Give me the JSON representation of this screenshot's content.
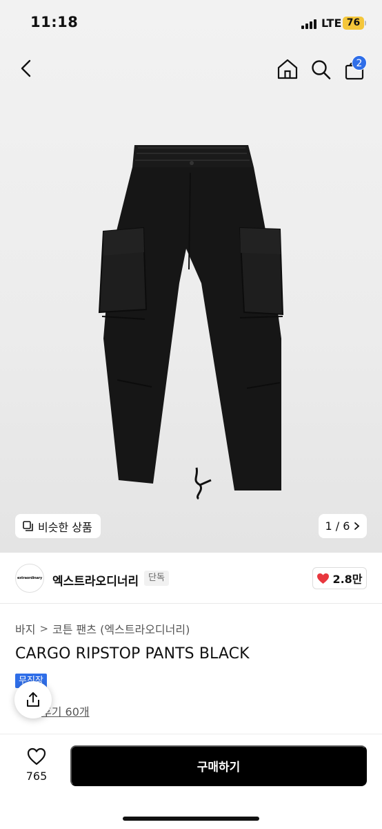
{
  "status_bar": {
    "time": "11:18",
    "network": "LTE",
    "battery": "76"
  },
  "header": {
    "cart_count": "2"
  },
  "gallery": {
    "similar_label": "비슷한 상품",
    "pager": "1 / 6"
  },
  "brand": {
    "logo_text": "extraordinary",
    "name": "엑스트라오디너리",
    "tag": "단독",
    "likes": "2.8만"
  },
  "product": {
    "breadcrumb": [
      "바지",
      "코튼 팬츠 (엑스트라오디너리)"
    ],
    "title": "CARGO RIPSTOP PANTS BLACK",
    "badge": "무진장",
    "reviews": "후기 60개"
  },
  "bottom_bar": {
    "wish_count": "765",
    "buy_label": "구매하기"
  },
  "colors": {
    "accent": "#2f6ee8",
    "heart": "#e8373e",
    "buy_button": "#000000",
    "battery": "#f4c63a"
  },
  "icons": [
    "back-chevron-icon",
    "home-icon",
    "search-icon",
    "shopping-bag-icon",
    "similar-items-icon",
    "chevron-right-icon",
    "heart-icon",
    "share-icon",
    "heart-outline-icon"
  ]
}
